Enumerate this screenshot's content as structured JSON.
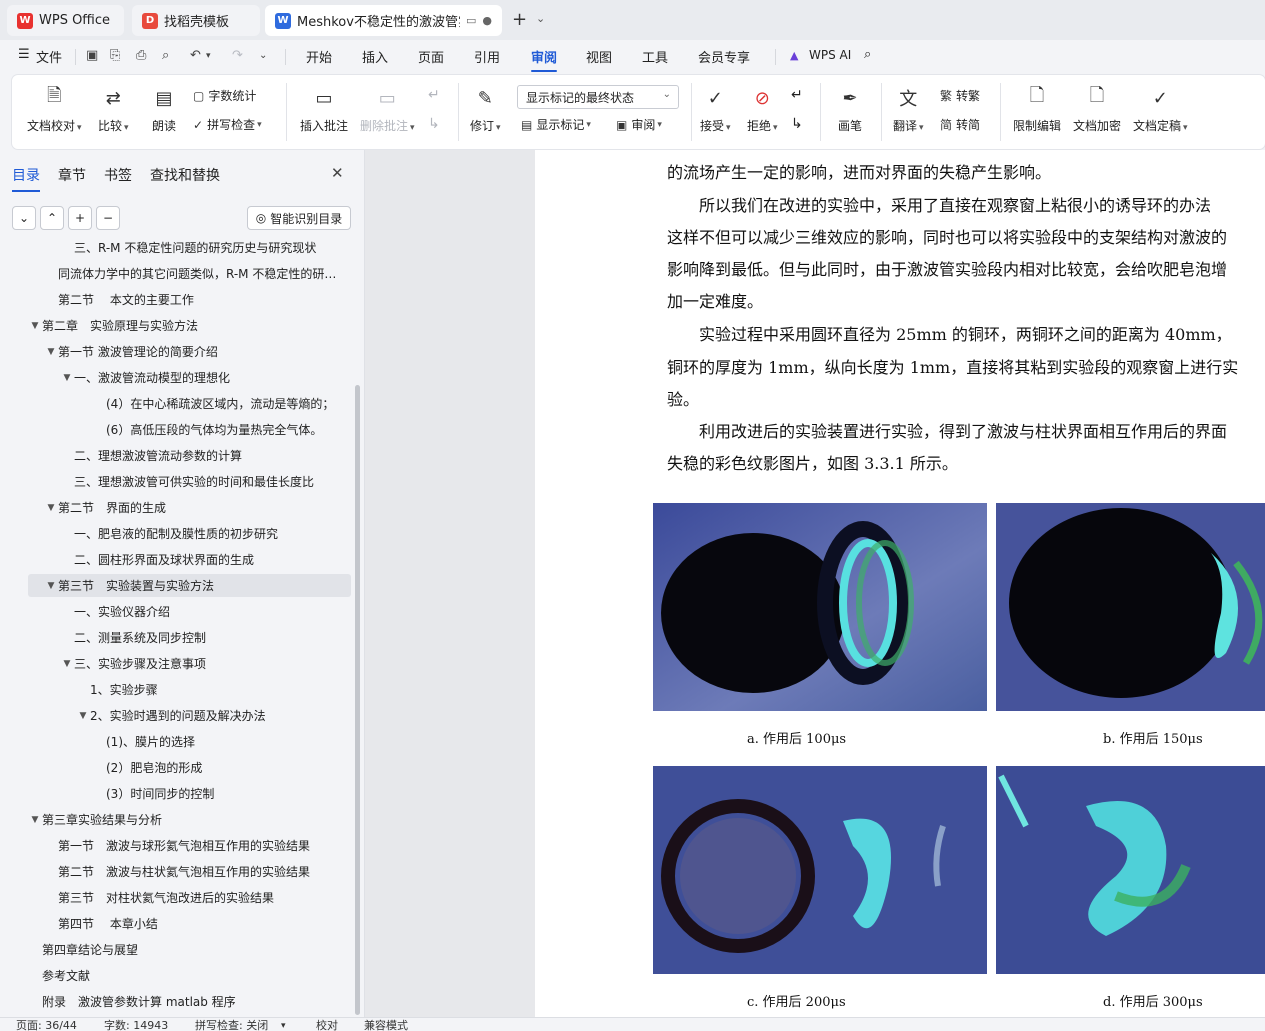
{
  "tabs": [
    {
      "label": "WPS Office",
      "icon": "wps-logo-icon",
      "color": "#e8312f"
    },
    {
      "label": "找稻壳模板",
      "icon": "docer-icon",
      "color": "#e84a3d"
    },
    {
      "label": "Meshkov不稳定性的激波管实",
      "icon": "word-doc-icon",
      "color": "#2f6bde"
    }
  ],
  "menubar": {
    "file": "文件",
    "items": [
      "开始",
      "插入",
      "页面",
      "引用",
      "审阅",
      "视图",
      "工具",
      "会员专享"
    ],
    "active": "审阅",
    "wps_ai": "WPS AI"
  },
  "ribbon": {
    "proofread": "文档校对",
    "compare": "比较",
    "read_aloud": "朗读",
    "word_count": "字数统计",
    "spell_check": "拼写检查",
    "insert_comment": "插入批注",
    "delete_comment": "删除批注",
    "revise": "修订",
    "markup_select": "显示标记的最终状态",
    "show_markup": "显示标记",
    "review_pane": "审阅",
    "accept": "接受",
    "reject": "拒绝",
    "pen": "画笔",
    "translate": "翻译",
    "to_traditional": "转繁",
    "to_simplified": "转简",
    "restrict_edit": "限制编辑",
    "encrypt": "文档加密",
    "finalize": "文档定稿"
  },
  "nav": {
    "tabs": [
      "目录",
      "章节",
      "书签",
      "查找和替换"
    ],
    "active_tab": "目录",
    "smart_toc": "智能识别目录",
    "toc": [
      {
        "text": "三、R-M 不稳定性问题的研究历史与研究现状",
        "indent": 2,
        "toggle": ""
      },
      {
        "text": "同流体力学中的其它问题类似，R-M 不稳定性的研…",
        "indent": 1,
        "toggle": ""
      },
      {
        "text": "第二节　 本文的主要工作",
        "indent": 1,
        "toggle": ""
      },
      {
        "text": "第二章　实验原理与实验方法",
        "indent": 0,
        "toggle": "▼"
      },
      {
        "text": "第一节  激波管理论的简要介绍",
        "indent": 1,
        "toggle": "▼"
      },
      {
        "text": "一、激波管流动模型的理想化",
        "indent": 2,
        "toggle": "▼"
      },
      {
        "text": "(4）在中心稀疏波区域内，流动是等熵的；",
        "indent": 4,
        "toggle": ""
      },
      {
        "text": "(6）高低压段的气体均为量热完全气体。",
        "indent": 4,
        "toggle": ""
      },
      {
        "text": "二、理想激波管流动参数的计算",
        "indent": 2,
        "toggle": ""
      },
      {
        "text": "三、理想激波管可供实验的时间和最佳长度比",
        "indent": 2,
        "toggle": ""
      },
      {
        "text": "第二节　界面的生成",
        "indent": 1,
        "toggle": "▼"
      },
      {
        "text": "一、肥皂液的配制及膜性质的初步研究",
        "indent": 2,
        "toggle": ""
      },
      {
        "text": "二、圆柱形界面及球状界面的生成",
        "indent": 2,
        "toggle": ""
      },
      {
        "text": "第三节　实验装置与实验方法",
        "indent": 1,
        "toggle": "▼",
        "selected": true
      },
      {
        "text": "一、实验仪器介绍",
        "indent": 2,
        "toggle": ""
      },
      {
        "text": "二、测量系统及同步控制",
        "indent": 2,
        "toggle": ""
      },
      {
        "text": "三、实验步骤及注意事项",
        "indent": 2,
        "toggle": "▼"
      },
      {
        "text": "1、实验步骤",
        "indent": 3,
        "toggle": ""
      },
      {
        "text": "2、实验时遇到的问题及解决办法",
        "indent": 3,
        "toggle": "▼"
      },
      {
        "text": "(1)、膜片的选择",
        "indent": 4,
        "toggle": ""
      },
      {
        "text": "(2）肥皂泡的形成",
        "indent": 4,
        "toggle": ""
      },
      {
        "text": "(3）时间同步的控制",
        "indent": 4,
        "toggle": ""
      },
      {
        "text": "第三章实验结果与分析",
        "indent": 0,
        "toggle": "▼"
      },
      {
        "text": "第一节　激波与球形氦气泡相互作用的实验结果",
        "indent": 1,
        "toggle": ""
      },
      {
        "text": "第二节　激波与柱状氦气泡相互作用的实验结果",
        "indent": 1,
        "toggle": ""
      },
      {
        "text": "第三节　对柱状氦气泡改进后的实验结果",
        "indent": 1,
        "toggle": ""
      },
      {
        "text": "第四节　 本章小结",
        "indent": 1,
        "toggle": ""
      },
      {
        "text": "第四章结论与展望",
        "indent": 0,
        "toggle": ""
      },
      {
        "text": "参考文献",
        "indent": 0,
        "toggle": ""
      },
      {
        "text": "附录　激波管参数计算 matlab 程序",
        "indent": 0,
        "toggle": ""
      }
    ]
  },
  "doc": {
    "lines": [
      "的流场产生一定的影响，进而对界面的失稳产生影响。",
      "　　所以我们在改进的实验中，采用了直接在观察窗上粘很小的诱导环的办法",
      "这样不但可以减少三维效应的影响，同时也可以将实验段中的支架结构对激波的",
      "影响降到最低。但与此同时，由于激波管实验段内相对比较宽，会给吹肥皂泡增",
      "加一定难度。",
      "　　实验过程中采用圆环直径为 25mm 的铜环，两铜环之间的距离为 40mm，",
      "铜环的厚度为 1mm，纵向长度为 1mm，直接将其粘到实验段的观察窗上进行实",
      "验。",
      "　　利用改进后的实验装置进行实验，得到了激波与柱状界面相互作用后的界面",
      "失稳的彩色纹影图片，如图 3.3.1 所示。"
    ],
    "captions": [
      "a. 作用后 100μs",
      "b. 作用后 150μs",
      "c. 作用后 200μs",
      "d. 作用后 300μs"
    ]
  },
  "status": {
    "page": "页面: 36/44",
    "words": "字数: 14943",
    "spell": "拼写检查: 关闭",
    "proof": "校对",
    "compat": "兼容模式"
  }
}
